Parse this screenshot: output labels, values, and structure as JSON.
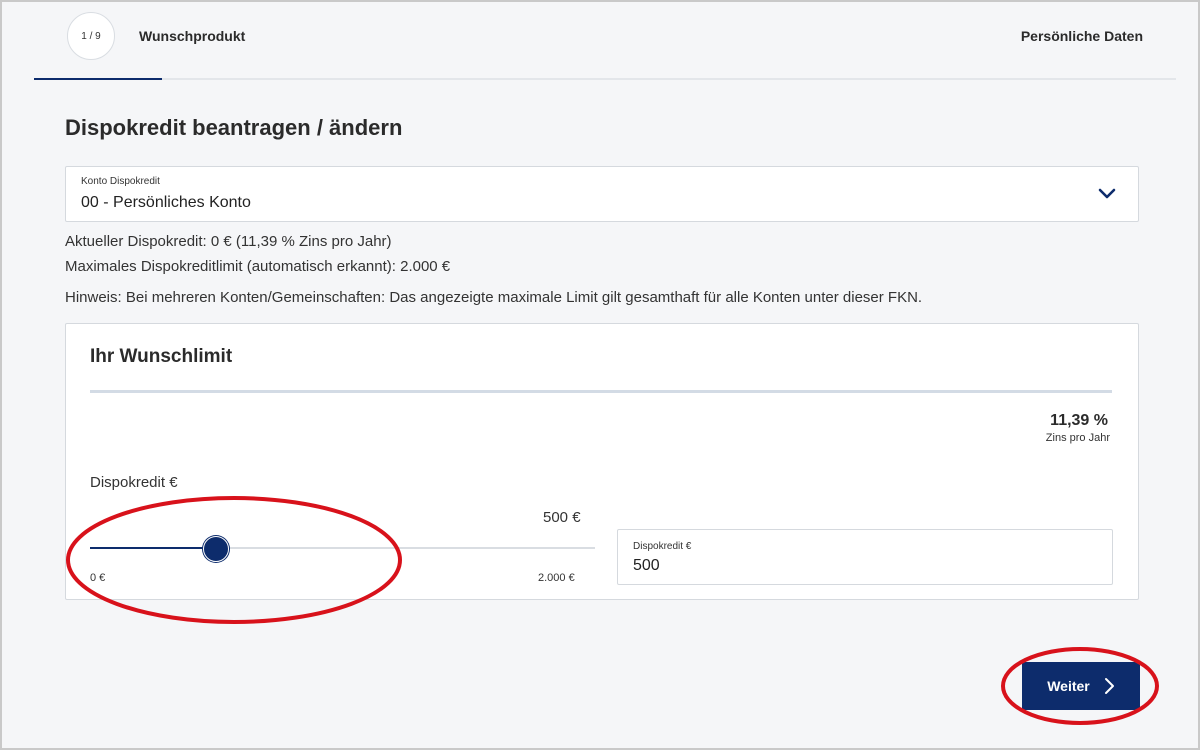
{
  "stepper": {
    "counter": "1 / 9",
    "current_step": "Wunschprodukt",
    "next_step": "Persönliche Daten"
  },
  "page_title": "Dispokredit beantragen / ändern",
  "account_select": {
    "label": "Konto Dispokredit",
    "value": "00 - Persönliches Konto"
  },
  "info": {
    "current_limit": "Aktueller Dispokredit:  0 € (11,39 % Zins pro Jahr)",
    "max_limit": "Maximales Dispokreditlimit (automatisch erkannt): 2.000 €",
    "note": "Hinweis: Bei mehreren Konten/Gemeinschaften: Das angezeigte maximale Limit gilt gesamthaft für alle Konten unter dieser FKN."
  },
  "wish_limit": {
    "title": "Ihr Wunschlimit",
    "rate_value": "11,39 %",
    "rate_label": "Zins pro Jahr",
    "slider_title": "Dispokredit €",
    "slider_value_label": "500 €",
    "slider_min_label": "0 €",
    "slider_max_label": "2.000 €",
    "slider_min": 0,
    "slider_max": 2000,
    "slider_current": 500,
    "input_label": "Dispokredit €",
    "input_value": "500"
  },
  "next_button": {
    "label": "Weiter"
  },
  "colors": {
    "primary": "#0d2c6c",
    "highlight": "#d8121b",
    "background": "#f5f6f8"
  },
  "icons": {
    "select_chevron": "chevron-down-icon",
    "next_chevron": "chevron-right-icon"
  }
}
